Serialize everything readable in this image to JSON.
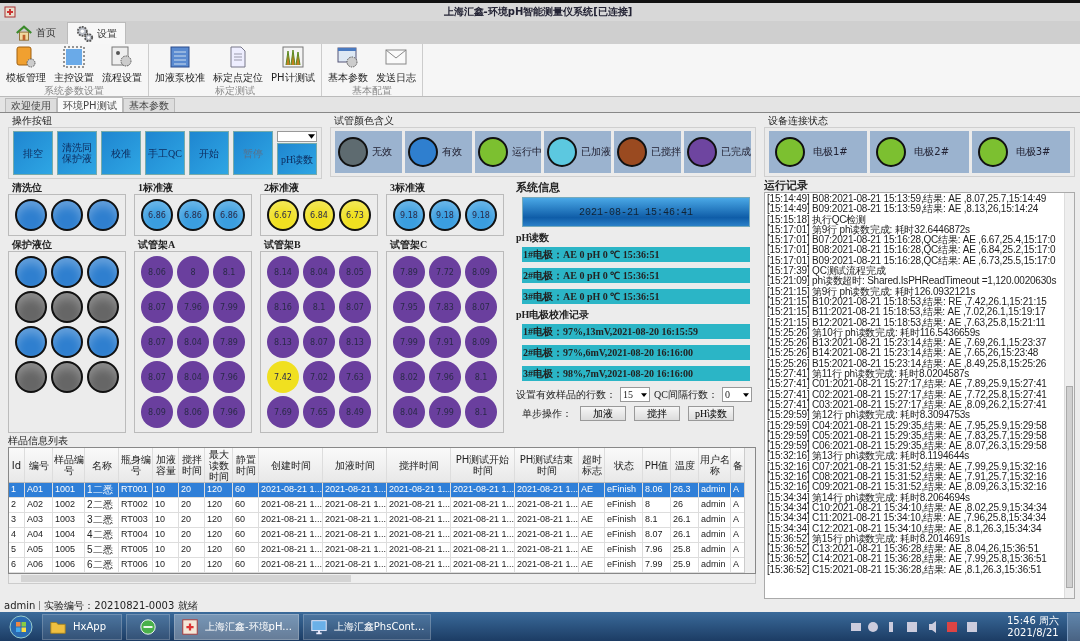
{
  "window": {
    "title": "上海汇鑫-环境pH智能测量仪系统[已连接]"
  },
  "ribbon": {
    "tabs": [
      {
        "label": "首页",
        "kind": "home",
        "selected": false
      },
      {
        "label": "设置",
        "kind": "gear",
        "selected": true
      }
    ],
    "groups": [
      {
        "caption": "系统参数设置",
        "items": [
          {
            "label": "模板管理",
            "kind": "template"
          },
          {
            "label": "主控设置",
            "kind": "master"
          },
          {
            "label": "流程设置",
            "kind": "flow"
          }
        ]
      },
      {
        "caption": "标定测试",
        "items": [
          {
            "label": "加液泵校准",
            "kind": "pump"
          },
          {
            "label": "标定点定位",
            "kind": "calib"
          },
          {
            "label": "PH计测试",
            "kind": "phmeter"
          }
        ]
      },
      {
        "caption": "基本配置",
        "items": [
          {
            "label": "基本参数",
            "kind": "params"
          },
          {
            "label": "发送日志",
            "kind": "mail"
          }
        ]
      }
    ]
  },
  "doc_tabs": [
    {
      "label": "欢迎使用",
      "selected": false
    },
    {
      "label": "环境PH测试",
      "selected": true
    },
    {
      "label": "基本参数",
      "selected": false
    }
  ],
  "operations": {
    "title": "操作按钮",
    "buttons": [
      {
        "label": "排空",
        "disabled": false
      },
      {
        "label": "清洗同保护液",
        "disabled": false
      },
      {
        "label": "校准",
        "disabled": false
      },
      {
        "label": "手工QC",
        "disabled": false
      },
      {
        "label": "开始",
        "disabled": false
      },
      {
        "label": "暂停",
        "disabled": true
      },
      {
        "label": "pH读数",
        "disabled": false
      }
    ]
  },
  "legend": {
    "title": "试管颜色含义",
    "items": [
      {
        "label": "无效",
        "color": "#5e6b70"
      },
      {
        "label": "有效",
        "color": "#2f7fcf"
      },
      {
        "label": "运行中",
        "color": "#7cc030"
      },
      {
        "label": "已加液",
        "color": "#5cc8e0"
      },
      {
        "label": "已搅拌",
        "color": "#9a4a20"
      },
      {
        "label": "已完成",
        "color": "#6e45a0"
      }
    ]
  },
  "devices": {
    "title": "设备连接状态",
    "items": [
      {
        "label": "电极1#",
        "color": "#7cc030"
      },
      {
        "label": "电极2#",
        "color": "#7cc030"
      },
      {
        "label": "电极3#",
        "color": "#7cc030"
      }
    ]
  },
  "stations": [
    {
      "title": "清洗位",
      "kind": "station",
      "tubes": [
        {
          "color": "#2f7fcf"
        },
        {
          "color": "#2f7fcf"
        },
        {
          "color": "#2f7fcf"
        }
      ]
    },
    {
      "title": "1标准液",
      "kind": "station",
      "tubes": [
        {
          "color": "#3a9ee0",
          "value": "6.86"
        },
        {
          "color": "#3a9ee0",
          "value": "6.86"
        },
        {
          "color": "#3a9ee0",
          "value": "6.86"
        }
      ]
    },
    {
      "title": "2标准液",
      "kind": "station",
      "tubes": [
        {
          "color": "#f0e020",
          "value": "6.67"
        },
        {
          "color": "#f0e020",
          "value": "6.84"
        },
        {
          "color": "#f0e020",
          "value": "6.73"
        }
      ]
    },
    {
      "title": "3标准液",
      "kind": "station",
      "tubes": [
        {
          "color": "#3a9ee0",
          "value": "9.18"
        },
        {
          "color": "#3a9ee0",
          "value": "9.18"
        },
        {
          "color": "#3a9ee0",
          "value": "9.18"
        }
      ]
    },
    {
      "title": "保护液位",
      "kind": "station",
      "tubes": [
        {
          "color": "#2f7fcf"
        },
        {
          "color": "#2f7fcf"
        },
        {
          "color": "#2f7fcf"
        },
        {
          "color": "#666666"
        },
        {
          "color": "#666666"
        },
        {
          "color": "#666666"
        },
        {
          "color": "#2f7fcf"
        },
        {
          "color": "#2f7fcf"
        },
        {
          "color": "#2f7fcf"
        },
        {
          "color": "#666666"
        },
        {
          "color": "#666666"
        },
        {
          "color": "#666666"
        }
      ]
    },
    {
      "title": "试管架A",
      "kind": "rack",
      "tubes": [
        {
          "color": "#6a3f9e",
          "value": "8.06"
        },
        {
          "color": "#6a3f9e",
          "value": "8"
        },
        {
          "color": "#6a3f9e",
          "value": "8.1"
        },
        {
          "color": "#6a3f9e",
          "value": "8.07"
        },
        {
          "color": "#6a3f9e",
          "value": "7.96"
        },
        {
          "color": "#6a3f9e",
          "value": "7.99"
        },
        {
          "color": "#6a3f9e",
          "value": "8.07"
        },
        {
          "color": "#6a3f9e",
          "value": "8.04"
        },
        {
          "color": "#6a3f9e",
          "value": "7.89"
        },
        {
          "color": "#6a3f9e",
          "value": "8.07"
        },
        {
          "color": "#6a3f9e",
          "value": "8.04"
        },
        {
          "color": "#6a3f9e",
          "value": "7.96"
        },
        {
          "color": "#6a3f9e",
          "value": "8.09"
        },
        {
          "color": "#6a3f9e",
          "value": "8.06"
        },
        {
          "color": "#6a3f9e",
          "value": "7.96"
        }
      ]
    },
    {
      "title": "试管架B",
      "kind": "rack",
      "tubes": [
        {
          "color": "#6a3f9e",
          "value": "8.14"
        },
        {
          "color": "#6a3f9e",
          "value": "8.04"
        },
        {
          "color": "#6a3f9e",
          "value": "8.05"
        },
        {
          "color": "#6a3f9e",
          "value": "8.16"
        },
        {
          "color": "#6a3f9e",
          "value": "8.1"
        },
        {
          "color": "#6a3f9e",
          "value": "8.07"
        },
        {
          "color": "#6a3f9e",
          "value": "8.13"
        },
        {
          "color": "#6a3f9e",
          "value": "8.07"
        },
        {
          "color": "#6a3f9e",
          "value": "8.13"
        },
        {
          "color": "#f0e020",
          "value": "7.42"
        },
        {
          "color": "#6a3f9e",
          "value": "7.02"
        },
        {
          "color": "#6a3f9e",
          "value": "7.63"
        },
        {
          "color": "#6a3f9e",
          "value": "7.69"
        },
        {
          "color": "#6a3f9e",
          "value": "7.65"
        },
        {
          "color": "#6a3f9e",
          "value": "8.49"
        }
      ]
    },
    {
      "title": "试管架C",
      "kind": "rack",
      "tubes": [
        {
          "color": "#6a3f9e",
          "value": "7.89"
        },
        {
          "color": "#6a3f9e",
          "value": "7.72"
        },
        {
          "color": "#6a3f9e",
          "value": "8.09"
        },
        {
          "color": "#6a3f9e",
          "value": "7.95"
        },
        {
          "color": "#6a3f9e",
          "value": "7.83"
        },
        {
          "color": "#6a3f9e",
          "value": "8.07"
        },
        {
          "color": "#6a3f9e",
          "value": "7.99"
        },
        {
          "color": "#6a3f9e",
          "value": "7.91"
        },
        {
          "color": "#6a3f9e",
          "value": "8.09"
        },
        {
          "color": "#6a3f9e",
          "value": "8.02"
        },
        {
          "color": "#6a3f9e",
          "value": "7.96"
        },
        {
          "color": "#6a3f9e",
          "value": "8.1"
        },
        {
          "color": "#6a3f9e",
          "value": "8.04"
        },
        {
          "color": "#6a3f9e",
          "value": "7.99"
        },
        {
          "color": "#6a3f9e",
          "value": "8.1"
        }
      ]
    }
  ],
  "system_info": {
    "title": "系统信息",
    "datetime": "2021-08-21 15:46:41",
    "ph_title": "pH读数",
    "ph_readings": [
      "1#电极：AE 0 pH 0 ℃ 15:36:51",
      "2#电极：AE 0 pH 0 ℃ 15:36:51",
      "3#电极：AE 0 pH 0 ℃ 15:36:51"
    ],
    "calib_title": "pH电极校准记录",
    "calibrations": [
      "1#电极：97%,13mV,2021-08-20 16:15:59",
      "2#电极：97%,6mV,2021-08-20 16:16:00",
      "3#电极：98%,7mV,2021-08-20 16:16:00"
    ],
    "rows_label": "设置有效样品的行数：",
    "rows_value": "15",
    "qc_label": "QC间隔行数：",
    "qc_value": "0",
    "step_label": "单步操作：",
    "step_buttons": [
      "加液",
      "搅拌",
      "pH读数"
    ]
  },
  "log": {
    "title": "运行记录",
    "lines": [
      "[15:14:49] B08:2021-08-21 15:13:59,结果: AE ,8.07,25.7,15:14:49",
      "[15:14:49] B09:2021-08-21 15:13:59,结果: AE ,8.13,26,15:14:24",
      "[15:15:18] 执行QC检测",
      "[15:17:01] 第9行 ph读数完成: 耗时32.6446872s",
      "[15:17:01] B07:2021-08-21 15:16:28,QC结果: AE ,6.67,25.4,15:17:0",
      "[15:17:01] B08:2021-08-21 15:16:28,QC结果: AE ,6.84,25.2,15:17:0",
      "[15:17:01] B09:2021-08-21 15:16:28,QC结果: AE ,6.73,25.5,15:17:0",
      "[15:17:39] QC测试流程完成",
      "[15:21:09] ph读数超时: Shared.IsPHReadTimeout =1,120.0020630s",
      "[15:21:15] 第9行 ph读数完成: 耗时126.0932121s",
      "[15:21:15] B10:2021-08-21 15:18:53,结果: RE ,7.42,26.1,15:21:15",
      "[15:21:15] B11:2021-08-21 15:18:53,结果: AE ,7.02,26.1,15:19:17",
      "[15:21:15] B12:2021-08-21 15:18:53,结果: AE ,7.63,25.8,15:21:11",
      "[15:25:26] 第10行 ph读数完成: 耗时116.5436659s",
      "[15:25:26] B13:2021-08-21 15:23:14,结果: AE ,7.69,26.1,15:23:37",
      "[15:25:26] B14:2021-08-21 15:23:14,结果: AE ,7.65,26,15:23:48",
      "[15:25:26] B15:2021-08-21 15:23:14,结果: AE ,8.49,25.8,15:25:26",
      "[15:27:41] 第11行 ph读数完成: 耗时8.0204587s",
      "[15:27:41] C01:2021-08-21 15:27:17,结果: AE ,7.89,25.9,15:27:41",
      "[15:27:41] C02:2021-08-21 15:27:17,结果: AE ,7.72,25.8,15:27:41",
      "[15:27:41] C03:2021-08-21 15:27:17,结果: AE ,8.09,26.2,15:27:41",
      "[15:29:59] 第12行 ph读数完成: 耗时8.3094753s",
      "[15:29:59] C04:2021-08-21 15:29:35,结果: AE ,7.95,25.9,15:29:58",
      "[15:29:59] C05:2021-08-21 15:29:35,结果: AE ,7.83,25.7,15:29:58",
      "[15:29:59] C06:2021-08-21 15:29:35,结果: AE ,8.07,26.3,15:29:58",
      "[15:32:16] 第13行 ph读数完成: 耗时8.1194644s",
      "[15:32:16] C07:2021-08-21 15:31:52,结果: AE ,7.99,25.9,15:32:16",
      "[15:32:16] C08:2021-08-21 15:31:52,结果: AE ,7.91,25.7,15:32:16",
      "[15:32:16] C09:2021-08-21 15:31:52,结果: AE ,8.09,26.3,15:32:16",
      "[15:34:34] 第14行 ph读数完成: 耗时8.2064694s",
      "[15:34:34] C10:2021-08-21 15:34:10,结果: AE ,8.02,25.9,15:34:34",
      "[15:34:34] C11:2021-08-21 15:34:10,结果: AE ,7.96,25.8,15:34:34",
      "[15:34:34] C12:2021-08-21 15:34:10,结果: AE ,8.1,26.3,15:34:34",
      "[15:36:52] 第15行 ph读数完成: 耗时8.2014691s",
      "[15:36:52] C13:2021-08-21 15:36:28,结果: AE ,8.04,26,15:36:51",
      "[15:36:52] C14:2021-08-21 15:36:28,结果: AE ,7.99,25.8,15:36:51",
      "[15:36:52] C15:2021-08-21 15:36:28,结果: AE ,8.1,26.3,15:36:51"
    ]
  },
  "table": {
    "title": "样品信息列表",
    "columns": [
      "Id",
      "编号",
      "样品编号",
      "名称",
      "瓶身编号",
      "加液容量",
      "搅拌时间",
      "最大读数时间",
      "静置时间",
      "创建时间",
      "加液时间",
      "搅拌时间",
      "PH测试开始时间",
      "PH测试结束时间",
      "超时标志",
      "状态",
      "PH值",
      "温度",
      "用户名称",
      "备"
    ],
    "rows": [
      {
        "selected": true,
        "cells": [
          "1",
          "A01",
          "1001",
          "1二悉",
          "RT001",
          "10",
          "20",
          "120",
          "60",
          "2021-08-21 1...",
          "2021-08-21 1...",
          "2021-08-21 1...",
          "2021-08-21 1...",
          "2021-08-21 1...",
          "AE",
          "eFinish",
          "8.06",
          "26.3",
          "admin",
          "A"
        ]
      },
      {
        "selected": false,
        "cells": [
          "2",
          "A02",
          "1002",
          "2二悉",
          "RT002",
          "10",
          "20",
          "120",
          "60",
          "2021-08-21 1...",
          "2021-08-21 1...",
          "2021-08-21 1...",
          "2021-08-21 1...",
          "2021-08-21 1...",
          "AE",
          "eFinish",
          "8",
          "26",
          "admin",
          "A"
        ]
      },
      {
        "selected": false,
        "cells": [
          "3",
          "A03",
          "1003",
          "3二悉",
          "RT003",
          "10",
          "20",
          "120",
          "60",
          "2021-08-21 1...",
          "2021-08-21 1...",
          "2021-08-21 1...",
          "2021-08-21 1...",
          "2021-08-21 1...",
          "AE",
          "eFinish",
          "8.1",
          "26.1",
          "admin",
          "A"
        ]
      },
      {
        "selected": false,
        "cells": [
          "4",
          "A04",
          "1004",
          "4二悉",
          "RT004",
          "10",
          "20",
          "120",
          "60",
          "2021-08-21 1...",
          "2021-08-21 1...",
          "2021-08-21 1...",
          "2021-08-21 1...",
          "2021-08-21 1...",
          "AE",
          "eFinish",
          "8.07",
          "26.1",
          "admin",
          "A"
        ]
      },
      {
        "selected": false,
        "cells": [
          "5",
          "A05",
          "1005",
          "5二悉",
          "RT005",
          "10",
          "20",
          "120",
          "60",
          "2021-08-21 1...",
          "2021-08-21 1...",
          "2021-08-21 1...",
          "2021-08-21 1...",
          "2021-08-21 1...",
          "AE",
          "eFinish",
          "7.96",
          "25.8",
          "admin",
          "A"
        ]
      },
      {
        "selected": false,
        "cells": [
          "6",
          "A06",
          "1006",
          "6二悉",
          "RT006",
          "10",
          "20",
          "120",
          "60",
          "2021-08-21 1...",
          "2021-08-21 1...",
          "2021-08-21 1...",
          "2021-08-21 1...",
          "2021-08-21 1...",
          "AE",
          "eFinish",
          "7.99",
          "25.9",
          "admin",
          "A"
        ]
      }
    ]
  },
  "status_bar": {
    "user": "admin",
    "experiment": "实验编号：20210821-0003",
    "state": "就绪"
  },
  "taskbar": {
    "items": [
      {
        "kind": "start"
      },
      {
        "kind": "folder",
        "label": "HxApp",
        "selected": false
      },
      {
        "kind": "browser",
        "selected": false
      },
      {
        "kind": "app",
        "label": "上海汇鑫-环境pH...",
        "selected": true
      },
      {
        "kind": "remote",
        "label": "上海汇鑫PhsCont...",
        "selected": false
      }
    ],
    "time": "15:46 周六",
    "date": "2021/8/21"
  }
}
